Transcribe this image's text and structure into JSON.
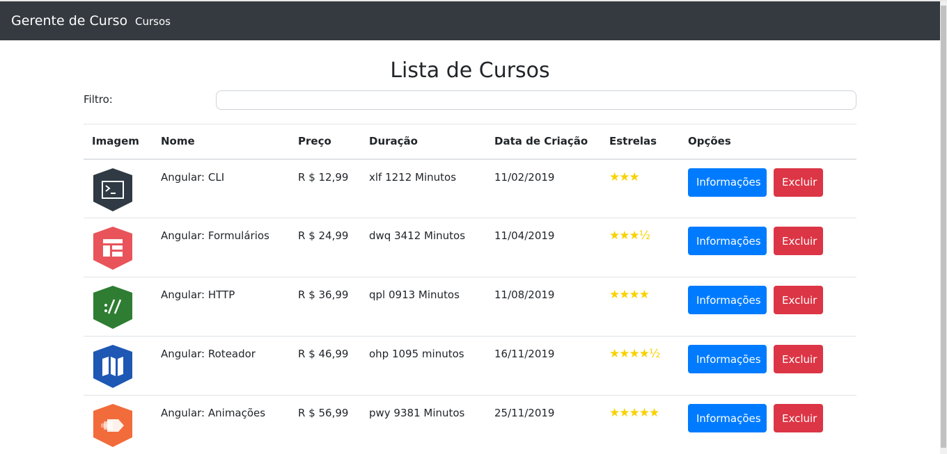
{
  "navbar": {
    "brand": "Gerente de Curso",
    "link": "Cursos"
  },
  "page": {
    "title": "Lista de Cursos"
  },
  "filter": {
    "label": "Filtro:",
    "value": "",
    "placeholder": ""
  },
  "table": {
    "headers": [
      "Imagem",
      "Nome",
      "Preço",
      "Duração",
      "Data de Criação",
      "Estrelas",
      "Opções"
    ],
    "rows": [
      {
        "icon": "angular-cli-icon",
        "color": "#2f3a44",
        "name": "Angular: CLI",
        "price": "R $ 12,99",
        "duration": "xlf 1212 Minutos",
        "date": "11/02/2019",
        "stars": "★★★",
        "rating": 3
      },
      {
        "icon": "angular-forms-icon",
        "color": "#e8545a",
        "name": "Angular: Formulários",
        "price": "R $ 24,99",
        "duration": "dwq 3412 Minutos",
        "date": "11/04/2019",
        "stars": "★★★½",
        "rating": 3.5
      },
      {
        "icon": "angular-http-icon",
        "color": "#2e7d32",
        "name": "Angular: HTTP",
        "price": "R $ 36,99",
        "duration": "qpl 0913 Minutos",
        "date": "11/08/2019",
        "stars": "★★★★",
        "rating": 4
      },
      {
        "icon": "angular-router-icon",
        "color": "#1e57b4",
        "name": "Angular: Roteador",
        "price": "R $ 46,99",
        "duration": "ohp 1095 minutos",
        "date": "16/11/2019",
        "stars": "★★★★½",
        "rating": 4.5
      },
      {
        "icon": "angular-animations-icon",
        "color": "#f26b3a",
        "name": "Angular: Animações",
        "price": "R $ 56,99",
        "duration": "pwy 9381 Minutos",
        "date": "25/11/2019",
        "stars": "★★★★★",
        "rating": 5
      }
    ],
    "buttons": {
      "info": "Informações",
      "delete": "Excluir"
    }
  },
  "colors": {
    "navbar": "#343a40",
    "primary": "#007bff",
    "danger": "#dc3545",
    "star": "#f8d200"
  }
}
